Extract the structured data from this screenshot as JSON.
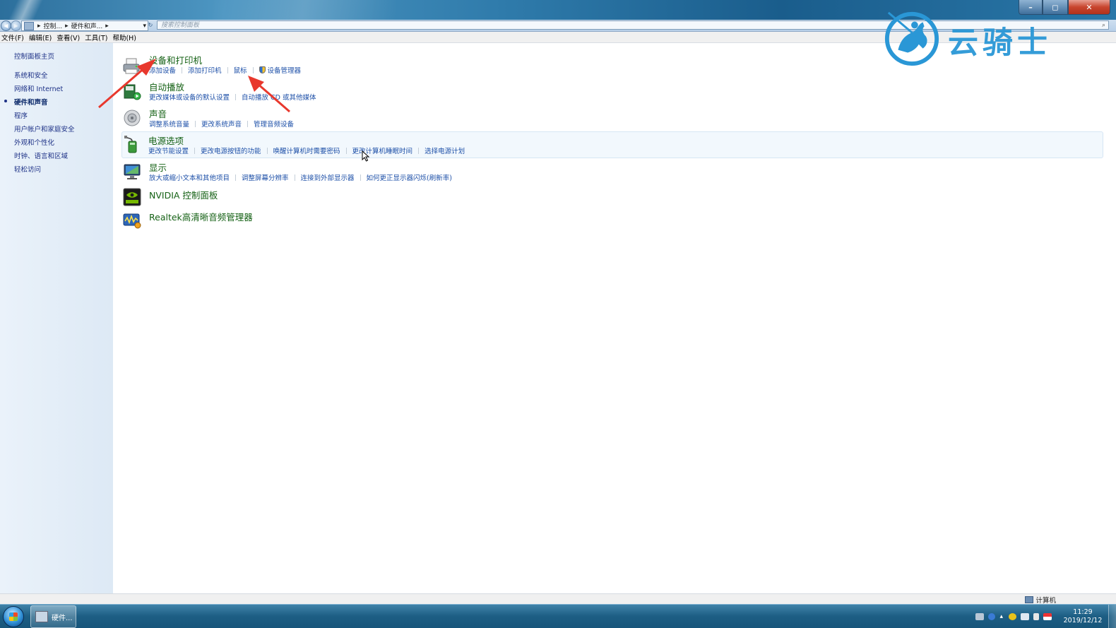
{
  "window": {
    "min_symbol": "–",
    "max_symbol": "◻",
    "close_symbol": "✕"
  },
  "address": {
    "crumbs": [
      "控制...",
      "硬件和声..."
    ],
    "search_placeholder": "搜索控制面板"
  },
  "menu": [
    "文件(F)",
    "编辑(E)",
    "查看(V)",
    "工具(T)",
    "帮助(H)"
  ],
  "sidebar": {
    "home": "控制面板主页",
    "items": [
      {
        "label": "系统和安全",
        "current": false
      },
      {
        "label": "网络和 Internet",
        "current": false
      },
      {
        "label": "硬件和声音",
        "current": true
      },
      {
        "label": "程序",
        "current": false
      },
      {
        "label": "用户帐户和家庭安全",
        "current": false
      },
      {
        "label": "外观和个性化",
        "current": false
      },
      {
        "label": "时钟、语言和区域",
        "current": false
      },
      {
        "label": "轻松访问",
        "current": false
      }
    ]
  },
  "categories": [
    {
      "title": "设备和打印机",
      "icon": "printer-icon",
      "links": [
        "添加设备",
        "添加打印机",
        "鼠标",
        "设备管理器"
      ]
    },
    {
      "title": "自动播放",
      "icon": "autoplay-icon",
      "links": [
        "更改媒体或设备的默认设置",
        "自动播放 CD 或其他媒体"
      ]
    },
    {
      "title": "声音",
      "icon": "speaker-icon",
      "links": [
        "调整系统音量",
        "更改系统声音",
        "管理音频设备"
      ]
    },
    {
      "title": "电源选项",
      "icon": "power-icon",
      "links": [
        "更改节能设置",
        "更改电源按钮的功能",
        "唤醒计算机时需要密码",
        "更改计算机睡眠时间",
        "选择电源计划"
      ]
    },
    {
      "title": "显示",
      "icon": "monitor-icon",
      "links": [
        "放大或缩小文本和其他项目",
        "调整屏幕分辨率",
        "连接到外部显示器",
        "如何更正显示器闪烁(刷新率)"
      ]
    },
    {
      "title": "NVIDIA 控制面板",
      "icon": "nvidia-icon",
      "links": []
    },
    {
      "title": "Realtek高清晰音频管理器",
      "icon": "realtek-icon",
      "links": []
    }
  ],
  "status": {
    "computer": "计算机"
  },
  "taskbar": {
    "task_label": "硬件...",
    "time": "11:29",
    "date": "2019/12/12"
  },
  "watermark": {
    "text": "云骑士"
  },
  "colors": {
    "category_title": "#156115",
    "link": "#1e50a8",
    "sidebar_link": "#1e3287",
    "annotation_arrow": "#e8382d"
  }
}
